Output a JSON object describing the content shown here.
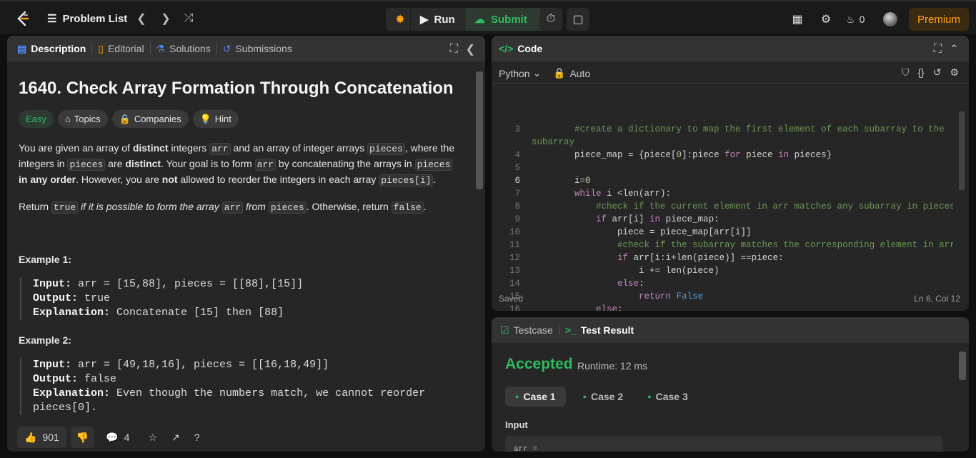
{
  "topbar": {
    "problem_list": "Problem List",
    "run": "Run",
    "submit": "Submit",
    "streak": "0",
    "premium": "Premium"
  },
  "left": {
    "tabs": [
      "Description",
      "Editorial",
      "Solutions",
      "Submissions"
    ],
    "title": "1640. Check Array Formation Through Concatenation",
    "chips": [
      "Easy",
      "Topics",
      "Companies",
      "Hint"
    ],
    "p1": {
      "a": "You are given an array of ",
      "b": "distinct",
      "c": " integers ",
      "arr": "arr",
      "d": " and an array of integer arrays ",
      "pieces": "pieces",
      "e": ", where the integers in ",
      "f": " are ",
      "g": "distinct",
      "h": ". Your goal is to form ",
      "i": " by concatenating the arrays in ",
      "j": " in any order",
      "k": ". However, you are ",
      "l": "not",
      "m": " allowed to reorder the integers in each array ",
      "n": "pieces[i]",
      "o": "."
    },
    "p2": {
      "a": "Return ",
      "t": "true",
      "b": " if it is possible to form the array ",
      "arr": "arr",
      "c": " from ",
      "p": "pieces",
      "d": ". Otherwise, return ",
      "f": "false",
      "e": "."
    },
    "ex1": {
      "title": "Example 1:",
      "in_l": "Input:",
      "in": " arr = [15,88], pieces = [[88],[15]]",
      "out_l": "Output:",
      "out": " true",
      "exp_l": "Explanation:",
      "exp": " Concatenate [15] then [88]"
    },
    "ex2": {
      "title": "Example 2:",
      "in_l": "Input:",
      "in": " arr = [49,18,16], pieces = [[16,18,49]]",
      "out_l": "Output:",
      "out": " false",
      "exp_l": "Explanation:",
      "exp": " Even though the numbers match, we cannot reorder",
      "exp2": "pieces[0]."
    },
    "likes": "901",
    "comments": "4"
  },
  "code": {
    "title": "Code",
    "lang": "Python",
    "auto": "Auto",
    "saved": "Saved",
    "pos": "Ln 6, Col 12",
    "line_numbers": [
      "3",
      "",
      "4",
      "5",
      "6",
      "7",
      "8",
      "9",
      "10",
      "11",
      "12",
      "13",
      "14",
      "15",
      "16"
    ]
  },
  "result": {
    "tab1": "Testcase",
    "tab2": "Test Result",
    "status": "Accepted",
    "runtime": "Runtime: 12 ms",
    "cases": [
      "Case 1",
      "Case 2",
      "Case 3"
    ],
    "input_label": "Input",
    "input_val": "arr ="
  }
}
